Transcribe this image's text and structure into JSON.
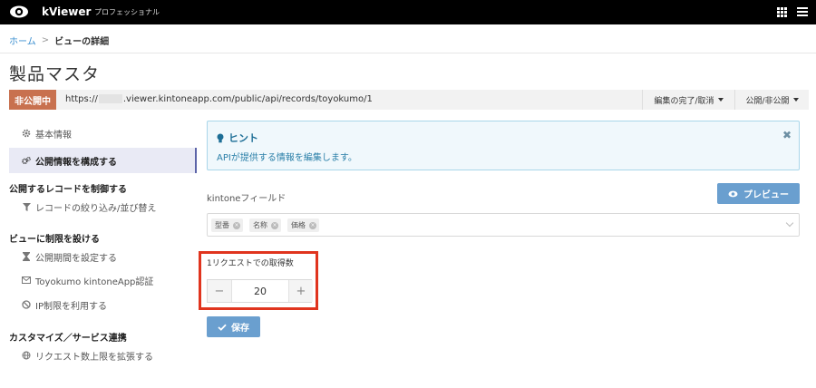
{
  "app": {
    "brand": "kViewer",
    "plan": "プロフェッショナル"
  },
  "breadcrumb": {
    "home": "ホーム",
    "separator": ">",
    "current": "ビューの詳細"
  },
  "page_title": "製品マスタ",
  "urlbar": {
    "status": "非公開中",
    "url_prefix": "https://",
    "url_suffix": ".viewer.kintoneapp.com/public/api/records/toyokumo/1",
    "edit_menu": "編集の完了/取消",
    "publish_menu": "公開/非公開"
  },
  "sidebar": {
    "items": [
      {
        "label": "基本情報",
        "icon": "gear-icon"
      },
      {
        "label": "公開情報を構成する",
        "icon": "gears-icon",
        "active": true
      }
    ],
    "section_records": "公開するレコードを制御する",
    "filter_item": "レコードの絞り込み/並び替え",
    "section_limits": "ビューに制限を設ける",
    "limit_items": [
      {
        "label": "公開期間を設定する",
        "icon": "hourglass-icon"
      },
      {
        "label": "Toyokumo kintoneApp認証",
        "icon": "envelope-icon"
      },
      {
        "label": "IP制限を利用する",
        "icon": "ban-icon"
      }
    ],
    "section_custom": "カスタマイズ／サービス連携",
    "custom_item": "リクエスト数上限を拡張する"
  },
  "hint": {
    "title": "ヒント",
    "body": "APIが提供する情報を編集します。",
    "close": "✖"
  },
  "fields": {
    "label": "kintoneフィールド",
    "preview_button": "プレビュー",
    "tags": [
      "型番",
      "名称",
      "価格"
    ]
  },
  "request": {
    "label": "1リクエストでの取得数",
    "value": "20",
    "minus": "−",
    "plus": "+"
  },
  "save_button": "保存",
  "colors": {
    "accent": "#6a9fcf",
    "status_badge": "#c8714f",
    "highlight": "#e0341e",
    "link": "#3b8fd0"
  }
}
